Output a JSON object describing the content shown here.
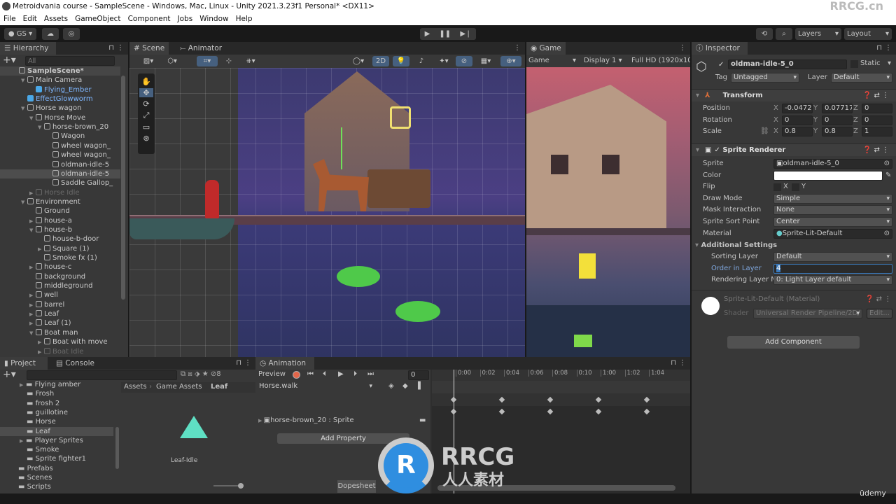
{
  "window": {
    "title": "Metroidvania course - SampleScene - Windows, Mac, Linux - Unity 2021.3.23f1 Personal* <DX11>"
  },
  "menu": [
    "File",
    "Edit",
    "Assets",
    "GameObject",
    "Component",
    "Jobs",
    "Window",
    "Help"
  ],
  "toolbar": {
    "account": "GS",
    "layers": "Layers",
    "layout": "Layout"
  },
  "hierarchy": {
    "title": "Hierarchy",
    "search_placeholder": "All",
    "items": [
      {
        "label": "SampleScene*",
        "indent": 0,
        "state": "scene"
      },
      {
        "label": "Main Camera",
        "indent": 1,
        "state": "normal",
        "expanded": true
      },
      {
        "label": "Flying_Ember",
        "indent": 2,
        "state": "prefab"
      },
      {
        "label": "EffectGlowworm",
        "indent": 1,
        "state": "prefab"
      },
      {
        "label": "Horse wagon",
        "indent": 1,
        "state": "normal",
        "expanded": true
      },
      {
        "label": "Horse Move",
        "indent": 2,
        "state": "normal",
        "expanded": true
      },
      {
        "label": "horse-brown_20",
        "indent": 3,
        "state": "normal",
        "expanded": true
      },
      {
        "label": "Wagon",
        "indent": 4,
        "state": "normal"
      },
      {
        "label": "wheel wagon_",
        "indent": 4,
        "state": "normal"
      },
      {
        "label": "wheel wagon_",
        "indent": 4,
        "state": "normal"
      },
      {
        "label": "oldman-idle-5",
        "indent": 4,
        "state": "normal"
      },
      {
        "label": "oldman-idle-5",
        "indent": 4,
        "state": "selected"
      },
      {
        "label": "Saddle Gallop_",
        "indent": 4,
        "state": "normal"
      },
      {
        "label": "Horse Idle",
        "indent": 2,
        "state": "disabled",
        "collapsed": true
      },
      {
        "label": "Environment",
        "indent": 1,
        "state": "normal",
        "expanded": true
      },
      {
        "label": "Ground",
        "indent": 2,
        "state": "normal"
      },
      {
        "label": "house-a",
        "indent": 2,
        "state": "normal",
        "collapsed": true
      },
      {
        "label": "house-b",
        "indent": 2,
        "state": "normal",
        "expanded": true
      },
      {
        "label": "house-b-door",
        "indent": 3,
        "state": "normal"
      },
      {
        "label": "Square (1)",
        "indent": 3,
        "state": "normal",
        "collapsed": true
      },
      {
        "label": "Smoke fx (1)",
        "indent": 3,
        "state": "normal"
      },
      {
        "label": "house-c",
        "indent": 2,
        "state": "normal",
        "collapsed": true
      },
      {
        "label": "background",
        "indent": 2,
        "state": "normal"
      },
      {
        "label": "middleground",
        "indent": 2,
        "state": "normal"
      },
      {
        "label": "well",
        "indent": 2,
        "state": "normal",
        "collapsed": true
      },
      {
        "label": "barrel",
        "indent": 2,
        "state": "normal",
        "collapsed": true
      },
      {
        "label": "Leaf",
        "indent": 2,
        "state": "normal",
        "collapsed": true
      },
      {
        "label": "Leaf (1)",
        "indent": 2,
        "state": "normal",
        "collapsed": true
      },
      {
        "label": "Boat man",
        "indent": 2,
        "state": "normal",
        "expanded": true
      },
      {
        "label": "Boat with move",
        "indent": 3,
        "state": "normal",
        "collapsed": true
      },
      {
        "label": "Boat Idle",
        "indent": 3,
        "state": "disabled",
        "collapsed": true
      }
    ]
  },
  "scene": {
    "tabs": [
      "Scene",
      "Animator"
    ],
    "mode_2d": "2D",
    "hidden_count": ""
  },
  "game": {
    "tab": "Game",
    "view": "Game",
    "display": "Display 1",
    "resolution": "Full HD (1920x108"
  },
  "inspector": {
    "title": "Inspector",
    "object_name": "oldman-idle-5_0",
    "static_label": "Static",
    "tag_label": "Tag",
    "tag": "Untagged",
    "layer_label": "Layer",
    "layer": "Default",
    "transform": {
      "title": "Transform",
      "rows": [
        {
          "label": "Position",
          "x": "-0.0472",
          "y": "0.07717",
          "z": "0"
        },
        {
          "label": "Rotation",
          "x": "0",
          "y": "0",
          "z": "0"
        },
        {
          "label": "Scale",
          "x": "0.8",
          "y": "0.8",
          "z": "1"
        }
      ]
    },
    "sprite_renderer": {
      "title": "Sprite Renderer",
      "sprite_label": "Sprite",
      "sprite": "oldman-idle-5_0",
      "color_label": "Color",
      "color": "#ffffff",
      "flip_label": "Flip",
      "flip_x": "X",
      "flip_y": "Y",
      "draw_mode_label": "Draw Mode",
      "draw_mode": "Simple",
      "mask_label": "Mask Interaction",
      "mask": "None",
      "sort_point_label": "Sprite Sort Point",
      "sort_point": "Center",
      "material_label": "Material",
      "material": "Sprite-Lit-Default",
      "additional_label": "Additional Settings",
      "sorting_layer_label": "Sorting Layer",
      "sorting_layer": "Default",
      "order_label": "Order in Layer",
      "order": "4",
      "rendering_layer_label": "Rendering Layer M",
      "rendering_layer": "0: Light Layer default"
    },
    "material": {
      "title": "Sprite-Lit-Default (Material)",
      "shader_label": "Shader",
      "shader": "Universal Render Pipeline/2D/",
      "edit": "Edit..."
    },
    "add_component": "Add Component"
  },
  "project": {
    "tabs": [
      "Project",
      "Console"
    ],
    "hidden_count": "8",
    "folders": [
      {
        "label": "Flying amber",
        "indent": 1,
        "collapsed": true
      },
      {
        "label": "Frosh",
        "indent": 1
      },
      {
        "label": "frosh 2",
        "indent": 1
      },
      {
        "label": "guillotine",
        "indent": 1
      },
      {
        "label": "Horse",
        "indent": 1
      },
      {
        "label": "Leaf",
        "indent": 1,
        "selected": true
      },
      {
        "label": "Player Sprites",
        "indent": 1,
        "collapsed": true
      },
      {
        "label": "Smoke",
        "indent": 1
      },
      {
        "label": "Sprite fighter1",
        "indent": 1
      },
      {
        "label": "Prefabs",
        "indent": 0
      },
      {
        "label": "Scenes",
        "indent": 0
      },
      {
        "label": "Scripts",
        "indent": 0
      }
    ],
    "breadcrumb": [
      "Assets",
      "Game Assets",
      "Leaf"
    ],
    "asset": "Leaf-Idle"
  },
  "animation": {
    "title": "Animation",
    "preview": "Preview",
    "frame": "0",
    "clip": "Horse.walk",
    "property": "horse-brown_20 : Sprite",
    "add_property": "Add Property",
    "dopesheet": "Dopesheet",
    "ticks": [
      "0:00",
      "0:02",
      "0:04",
      "0:06",
      "0:08",
      "0:10",
      "1:00",
      "1:02",
      "1:04"
    ],
    "keyframes": [
      "0:00",
      "0:04",
      "0:08",
      "1:00",
      "1:04"
    ]
  },
  "watermark": {
    "brand": "RRCG",
    "sub": "人人素材",
    "corner": "RRCG.cn",
    "udemy": "ūdemy"
  },
  "colors": {
    "accent": "#3a79bb",
    "selected": "#4d4d4d",
    "prefab": "#7fb7ff",
    "record": "#e2664a",
    "leaf": "#5fe0c4"
  }
}
